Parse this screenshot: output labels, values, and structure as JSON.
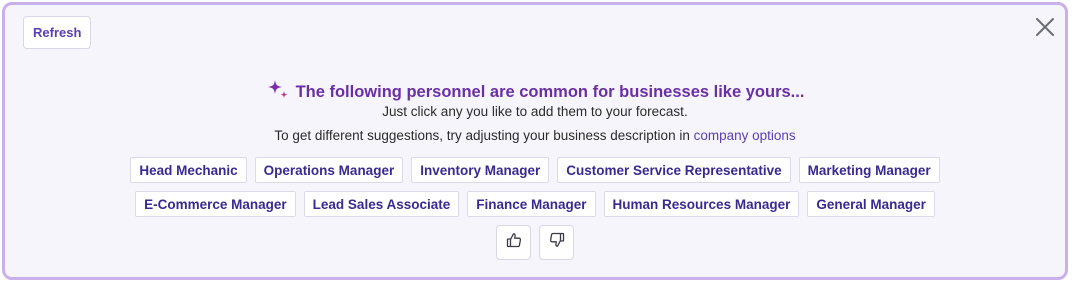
{
  "toolbar": {
    "refresh_label": "Refresh"
  },
  "header": {
    "title": "The following personnel are common for businesses like yours...",
    "line1": "Just click any you like to add them to your forecast.",
    "line2_prefix": "To get different suggestions, try adjusting your business description in ",
    "line2_link": "company options"
  },
  "suggestions": {
    "row1": [
      "Head Mechanic",
      "Operations Manager",
      "Inventory Manager",
      "Customer Service Representative",
      "Marketing Manager"
    ],
    "row2": [
      "E-Commerce Manager",
      "Lead Sales Associate",
      "Finance Manager",
      "Human Resources Manager",
      "General Manager"
    ]
  },
  "icons": {
    "close": "close-icon",
    "sparkle": "sparkle-icon",
    "thumbs_up": "thumbs-up-icon",
    "thumbs_down": "thumbs-down-icon"
  },
  "colors": {
    "panel_border": "#c8b1ea",
    "panel_bg": "#f6f5fc",
    "title": "#6a2fa3",
    "chip_text": "#3a2a8f",
    "link": "#5b3fb0"
  }
}
